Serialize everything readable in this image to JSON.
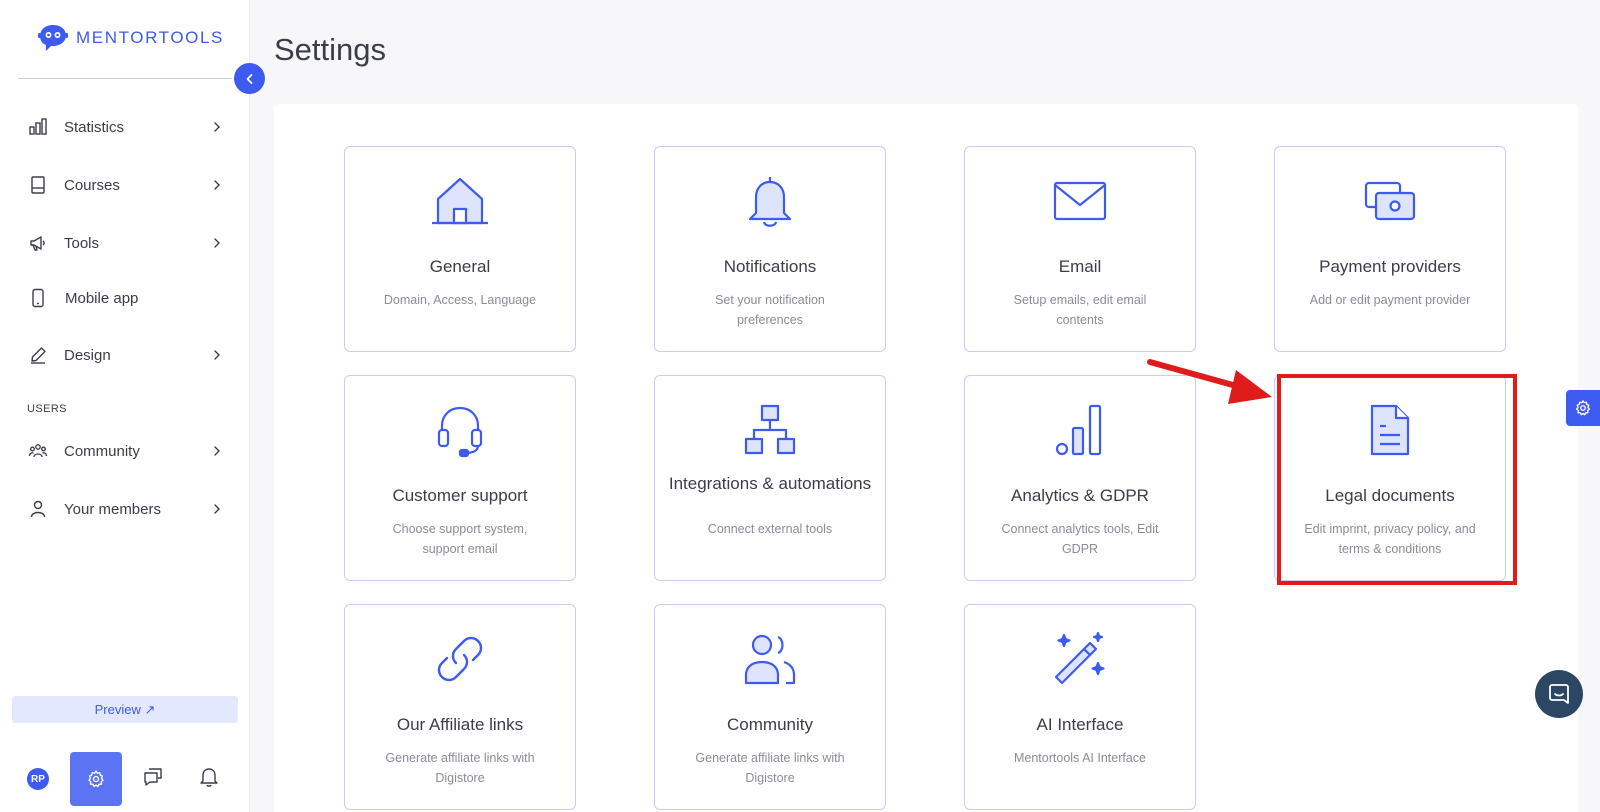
{
  "brand": {
    "name": "MENTORTOOLS",
    "accent": "#3d5af1"
  },
  "sidebar": {
    "items": [
      {
        "label": "Statistics",
        "icon": "bar-chart-icon",
        "has_submenu": true
      },
      {
        "label": "Courses",
        "icon": "book-icon",
        "has_submenu": true
      },
      {
        "label": "Tools",
        "icon": "megaphone-icon",
        "has_submenu": true
      },
      {
        "label": "Mobile app",
        "icon": "mobile-icon",
        "has_submenu": false
      },
      {
        "label": "Design",
        "icon": "pencil-icon",
        "has_submenu": true
      }
    ],
    "users_section_label": "USERS",
    "user_items": [
      {
        "label": "Community",
        "icon": "community-icon",
        "has_submenu": true
      },
      {
        "label": "Your members",
        "icon": "user-icon",
        "has_submenu": true
      }
    ],
    "preview_label": "Preview ↗",
    "avatar_initials": "RP"
  },
  "main": {
    "title": "Settings",
    "cards": [
      {
        "title": "General",
        "desc": "Domain, Access, Language",
        "icon": "home-icon"
      },
      {
        "title": "Notifications",
        "desc": "Set your notification preferences",
        "icon": "bell-icon"
      },
      {
        "title": "Email",
        "desc": "Setup emails, edit email contents",
        "icon": "envelope-icon"
      },
      {
        "title": "Payment providers",
        "desc": "Add or edit payment provider",
        "icon": "payment-icon"
      },
      {
        "title": "Customer support",
        "desc": "Choose support system, support email",
        "icon": "headset-icon"
      },
      {
        "title": "Integrations & automations",
        "desc": "Connect external tools",
        "icon": "hierarchy-icon"
      },
      {
        "title": "Analytics & GDPR",
        "desc": "Connect analytics tools, Edit GDPR",
        "icon": "analytics-icon"
      },
      {
        "title": "Legal documents",
        "desc": "Edit imprint, privacy policy, and terms & conditions",
        "icon": "document-icon"
      },
      {
        "title": "Our Affiliate links",
        "desc": "Generate affiliate links with Digistore",
        "icon": "link-icon"
      },
      {
        "title": "Community",
        "desc": "Generate affiliate links with Digistore",
        "icon": "users-icon"
      },
      {
        "title": "AI Interface",
        "desc": "Mentortools AI Interface",
        "icon": "magic-wand-icon"
      }
    ]
  },
  "annotation": {
    "highlight_color": "#e01b1b"
  }
}
